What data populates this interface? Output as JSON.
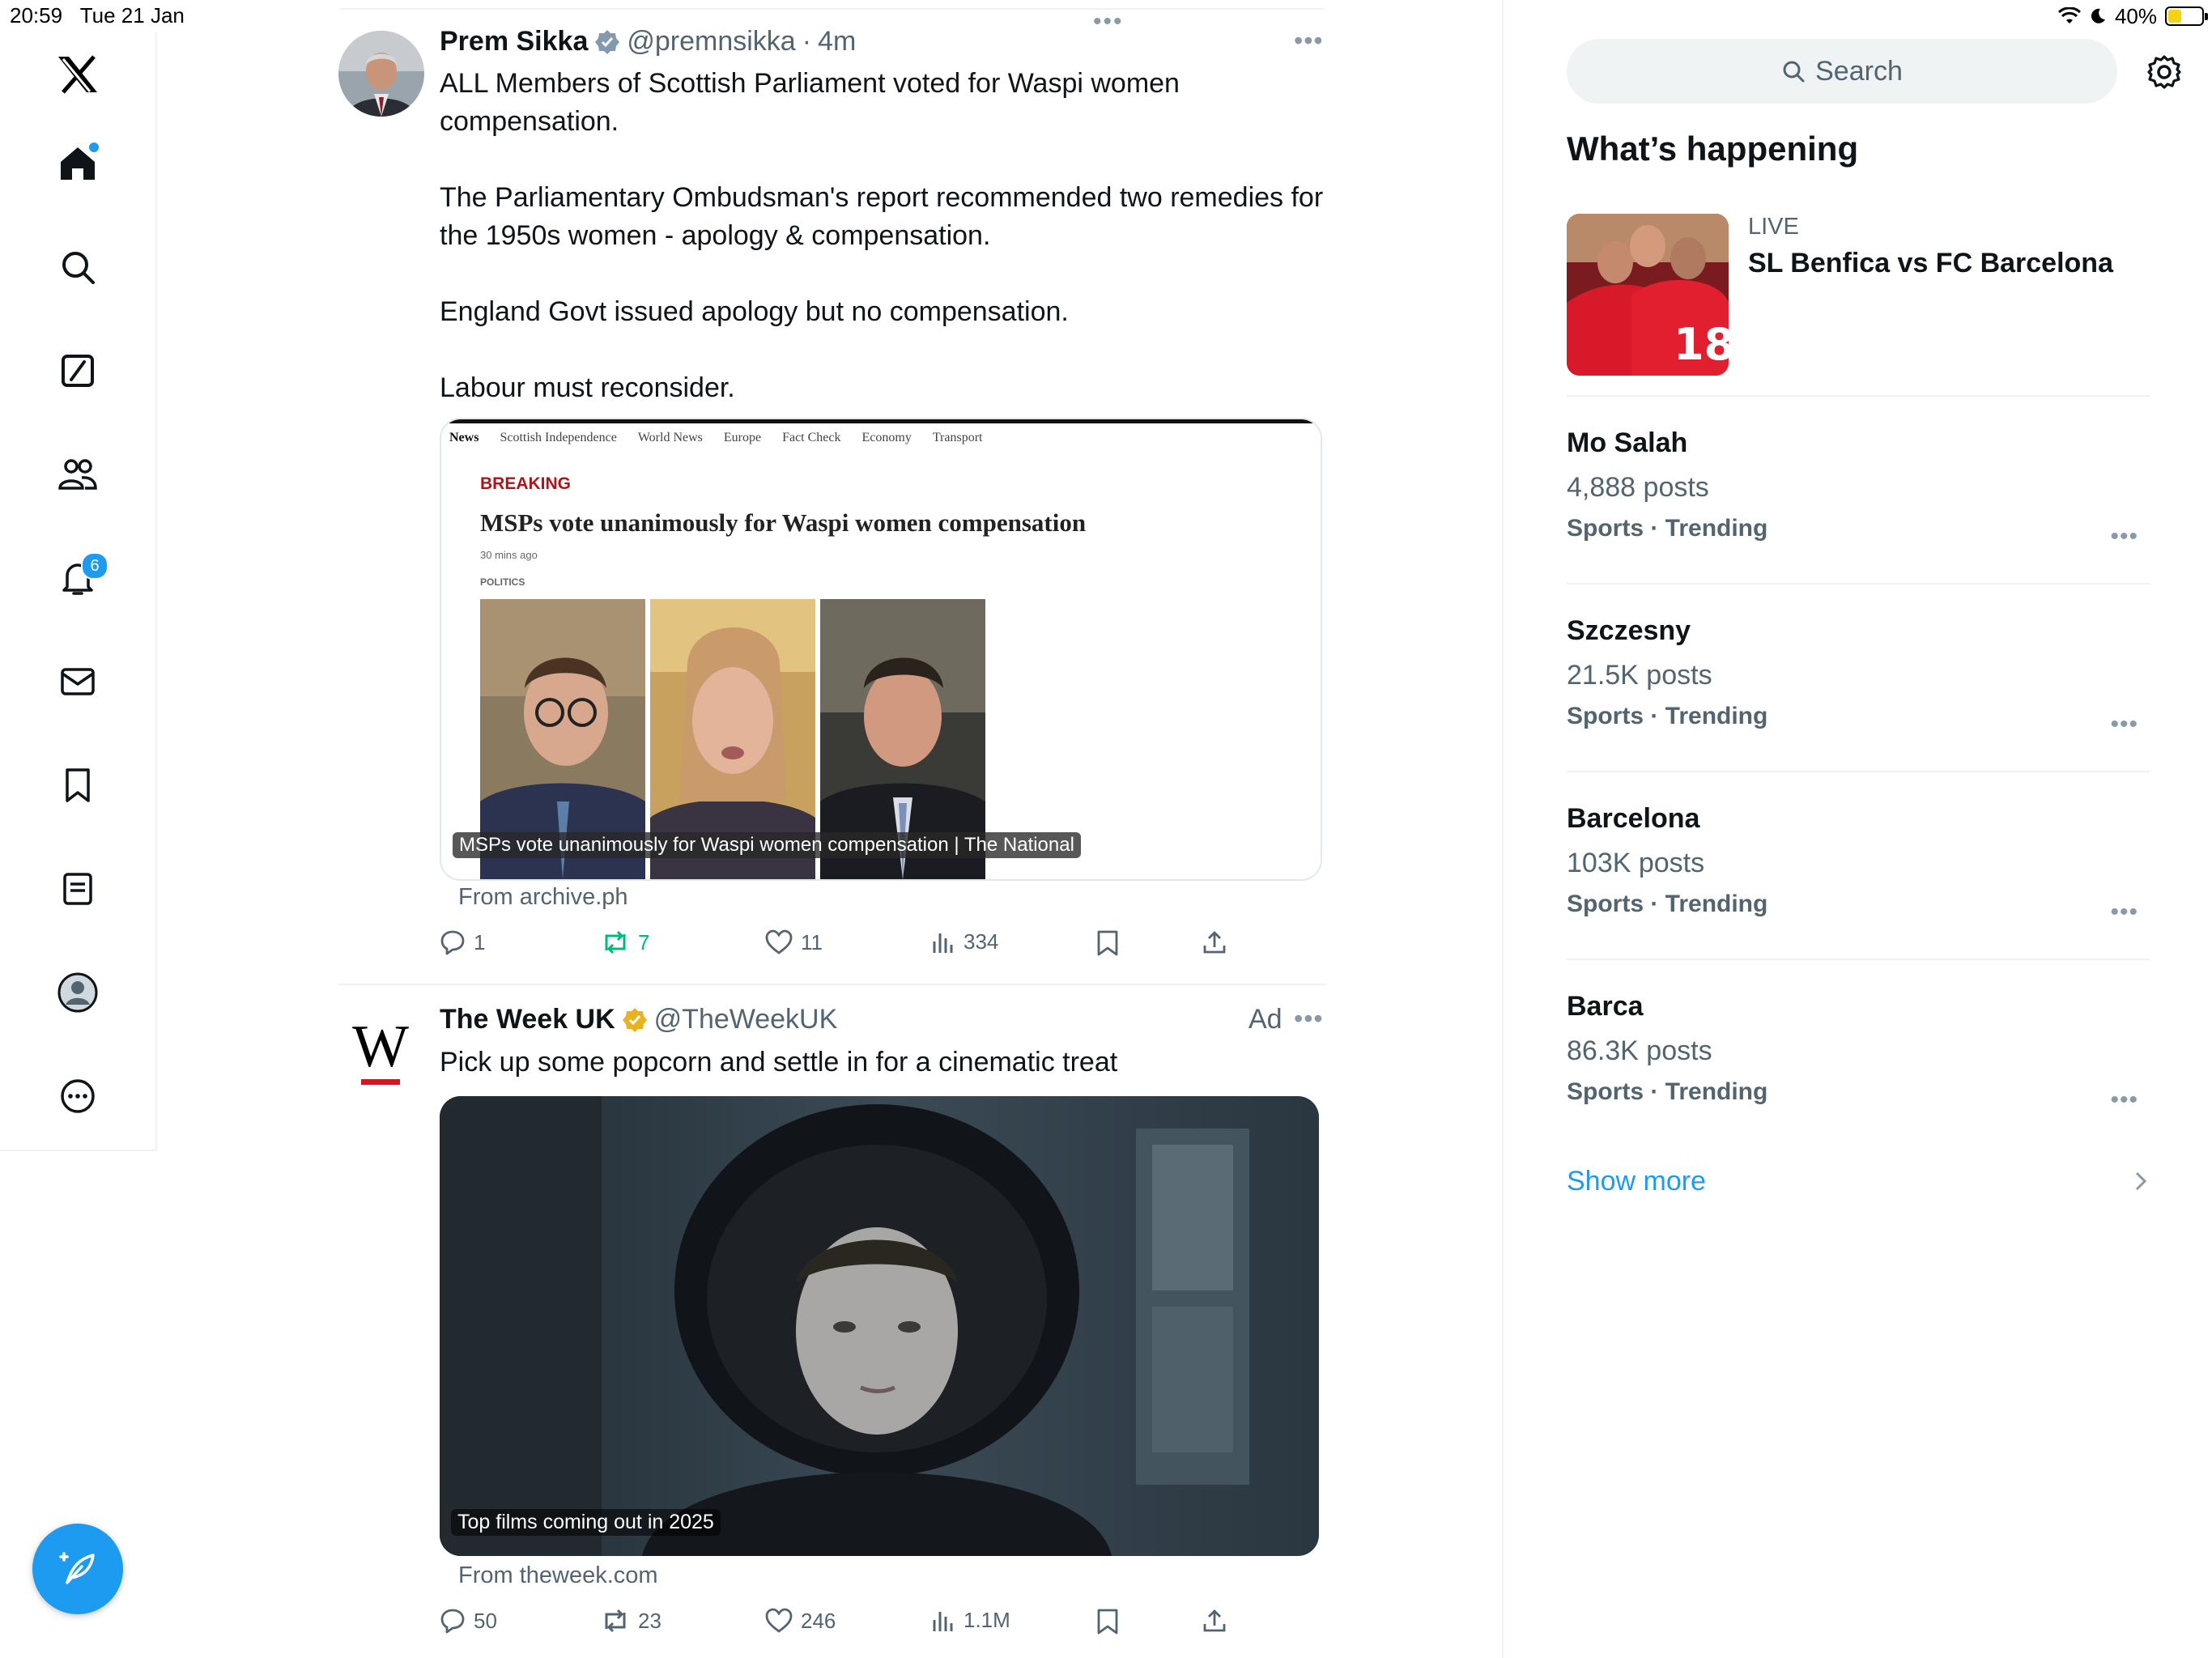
{
  "status_bar": {
    "time": "20:59",
    "date": "Tue 21 Jan",
    "battery": "40%",
    "battery_fraction": 0.4
  },
  "sidebar": {
    "logo": "x-logo-icon",
    "items": [
      {
        "name": "home",
        "icon": "home-icon"
      },
      {
        "name": "explore",
        "icon": "search-icon"
      },
      {
        "name": "grok",
        "icon": "grok-icon"
      },
      {
        "name": "communities",
        "icon": "people-icon"
      },
      {
        "name": "notifications",
        "icon": "bell-icon",
        "badge": "6"
      },
      {
        "name": "messages",
        "icon": "mail-icon"
      },
      {
        "name": "bookmarks",
        "icon": "bookmark-icon"
      },
      {
        "name": "lists",
        "icon": "list-icon"
      },
      {
        "name": "profile",
        "icon": "profile-icon"
      },
      {
        "name": "more",
        "icon": "more-circle-icon"
      }
    ],
    "compose_icon": "compose-icon"
  },
  "feed": {
    "tweets": [
      {
        "name": "Prem Sikka",
        "handle": "@premnsikka",
        "time": "4m",
        "text": "ALL Members of Scottish Parliament voted for Waspi women compensation.\n\nThe Parliamentary Ombudsman's report recommended two remedies for the 1950s women - apology & compensation.\n\nEngland Govt issued apology but no compensation.\n\nLabour must reconsider.",
        "card": {
          "nav": [
            "News",
            "Scottish Independence",
            "World News",
            "Europe",
            "Fact Check",
            "Economy",
            "Transport"
          ],
          "label": "BREAKING",
          "headline": "MSPs vote unanimously for Waspi women compensation",
          "time": "30 mins ago",
          "section": "POLITICS",
          "caption": "MSPs vote unanimously for Waspi women compensation | The National"
        },
        "from": "From archive.ph",
        "stats": {
          "replies": "1",
          "reposts": "7",
          "likes": "11",
          "views": "334"
        }
      },
      {
        "name": "The Week UK",
        "handle": "@TheWeekUK",
        "ad_label": "Ad",
        "text": "Pick up some popcorn and settle in for a cinematic treat",
        "media_caption": "Top films coming out in 2025",
        "from": "From theweek.com",
        "stats": {
          "replies": "50",
          "reposts": "23",
          "likes": "246",
          "views": "1.1M"
        }
      }
    ]
  },
  "right": {
    "search_placeholder": "Search",
    "heading": "What’s happening",
    "live": {
      "label": "LIVE",
      "title": "SL Benfica vs FC Barcelona",
      "jersey_number": "18"
    },
    "trends": [
      {
        "name": "Mo Salah",
        "posts": "4,888 posts",
        "category": "Sports · Trending"
      },
      {
        "name": "Szczesny",
        "posts": "21.5K posts",
        "category": "Sports · Trending"
      },
      {
        "name": "Barcelona",
        "posts": "103K posts",
        "category": "Sports · Trending"
      },
      {
        "name": "Barca",
        "posts": "86.3K posts",
        "category": "Sports · Trending"
      }
    ],
    "show_more": "Show more"
  },
  "colors": {
    "accent": "#1d9bf0",
    "repost_active": "#00ba7c",
    "breaking": "#b0141b"
  }
}
